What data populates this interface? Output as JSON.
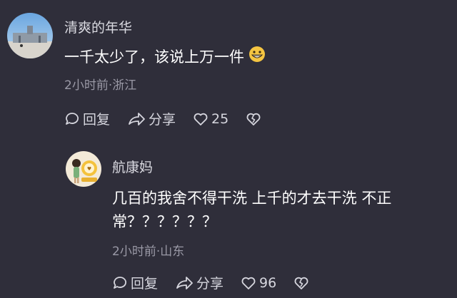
{
  "comments": [
    {
      "username": "清爽的年华",
      "text": "一千太少了，该说上万一件",
      "meta": "2小时前·浙江",
      "reply_label": "回复",
      "share_label": "分享",
      "like_count": "25"
    },
    {
      "username": "航康妈",
      "text_line1": "几百的我舍不得干洗   上千的才去干洗 不正",
      "text_line2": "常？？？？？？",
      "meta": "2小时前·山东",
      "reply_label": "回复",
      "share_label": "分享",
      "like_count": "96"
    }
  ],
  "colors": {
    "background": "#2f2e3a",
    "text": "#ffffff",
    "meta": "#9a99a6"
  }
}
